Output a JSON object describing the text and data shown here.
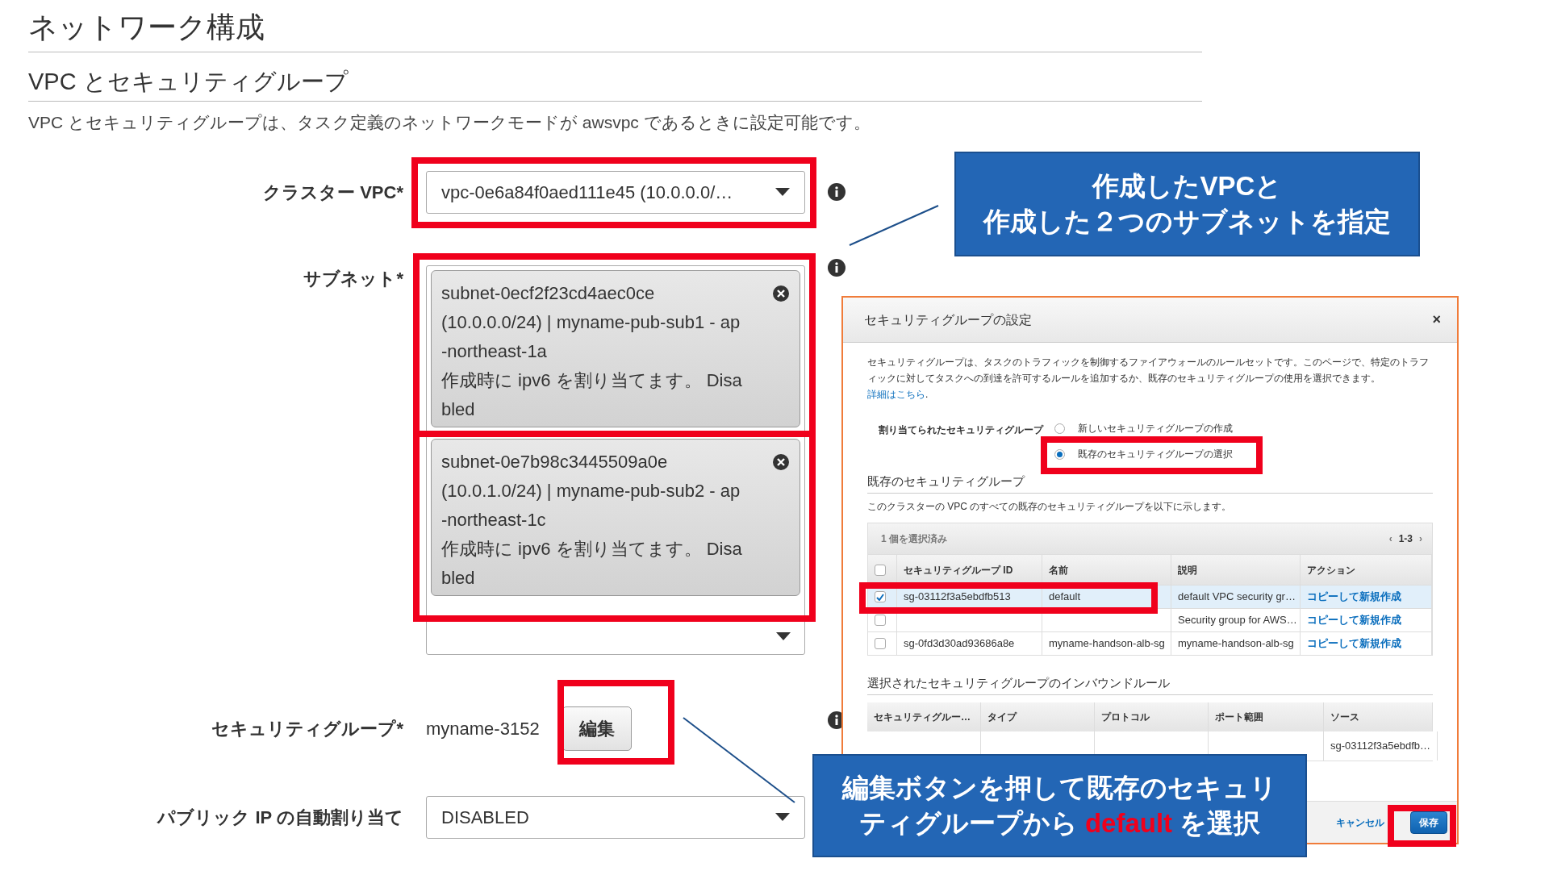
{
  "page": {
    "title": "ネットワーク構成",
    "section_title": "VPC とセキュリティグループ",
    "description": "VPC とセキュリティグループは、タスク定義のネットワークモードが awsvpc であるときに設定可能です。"
  },
  "form": {
    "vpc": {
      "label": "クラスター VPC*",
      "value": "vpc-0e6a84f0aed111e45 (10.0.0.0/…"
    },
    "subnets": {
      "label": "サブネット*",
      "chips": [
        {
          "lines": [
            "subnet-0ecf2f23cd4aec0ce",
            "(10.0.0.0/24) | myname-pub-sub1 - ap",
            "-northeast-1a",
            "作成時に ipv6 を割り当てます。 Disa",
            "bled"
          ]
        },
        {
          "lines": [
            "subnet-0e7b98c3445509a0e",
            "(10.0.1.0/24) | myname-pub-sub2 - ap",
            "-northeast-1c",
            "作成時に ipv6 を割り当てます。 Disa",
            "bled"
          ]
        }
      ]
    },
    "security_group": {
      "label": "セキュリティグループ*",
      "value": "myname-3152",
      "button": "編集"
    },
    "public_ip": {
      "label": "パブリック IP の自動割り当て",
      "value": "DISABLED"
    }
  },
  "dialog": {
    "title": "セキュリティグループの設定",
    "close": "×",
    "description": "セキュリティグループは、タスクのトラフィックを制御するファイアウォールのルールセットです。このページで、特定のトラフィックに対してタスクへの到達を許可するルールを追加するか、既存のセキュリティグループの使用を選択できます。",
    "link": "詳細はこちら",
    "link_tail": ".",
    "radio_label": "割り当てられたセキュリティグループ",
    "options": [
      {
        "label": "新しいセキュリティグループの作成",
        "selected": false
      },
      {
        "label": "既存のセキュリティグループの選択",
        "selected": true
      }
    ],
    "existing_heading": "既存のセキュリティグループ",
    "existing_note": "このクラスターの VPC のすべての既存のセキュリティグループを以下に示します。",
    "selection_count": "1 個を選択済み",
    "all_checked": false,
    "pager": {
      "prev": "‹",
      "range": "1-3",
      "next": "›"
    },
    "columns": [
      "セキュリティグループ ID",
      "名前",
      "説明",
      "アクション"
    ],
    "rows": [
      {
        "checked": true,
        "selected": true,
        "id": "sg-03112f3a5ebdfb513",
        "name": "default",
        "description": "default VPC security gr…",
        "action": "コピーして新規作成"
      },
      {
        "checked": false,
        "selected": false,
        "description": "Security group for AWS…",
        "action": "コピーして新規作成"
      },
      {
        "checked": false,
        "selected": false,
        "id": "sg-0fd3d30ad93686a8e",
        "name": "myname-handson-alb-sg",
        "description": "myname-handson-alb-sg",
        "action": "コピーして新規作成"
      }
    ],
    "inbound_heading": "選択されたセキュリティグループのインバウンドルール",
    "inbound_columns": [
      "セキュリティグルー…",
      "タイプ",
      "プロトコル",
      "ポート範囲",
      "ソース"
    ],
    "inbound_rows": [
      {
        "source": "sg-03112f3a5ebdfb…"
      }
    ],
    "cancel": "キャンセル",
    "save": "保存"
  },
  "callouts": [
    {
      "lines": [
        [
          {
            "text": "作成したVPCと",
            "highlight": false
          }
        ],
        [
          {
            "text": "作成した２つのサブネットを指定",
            "highlight": false
          }
        ]
      ]
    },
    {
      "lines": [
        [
          {
            "text": "編集ボタンを押して既存のセキュリ",
            "highlight": false
          }
        ],
        [
          {
            "text": "ティグループから ",
            "highlight": false
          },
          {
            "text": "default",
            "highlight": true
          },
          {
            "text": " を選択",
            "highlight": false
          }
        ]
      ]
    }
  ]
}
